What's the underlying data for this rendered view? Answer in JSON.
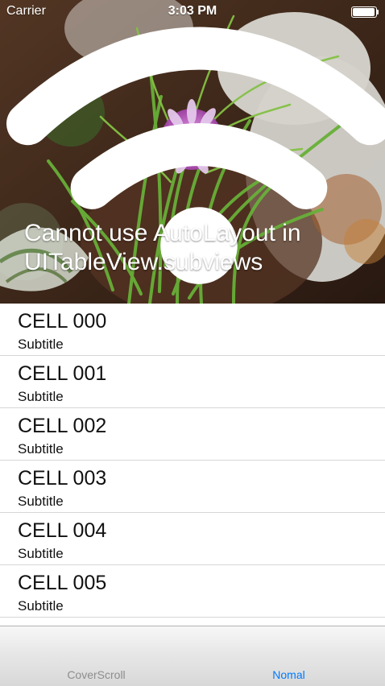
{
  "status_bar": {
    "carrier": "Carrier",
    "time": "3:03 PM"
  },
  "hero": {
    "title_line1": "Cannot use AutoLayout in",
    "title_line2": "UITableView.subviews"
  },
  "table": {
    "cells": [
      {
        "title": "CELL 000",
        "subtitle": "Subtitle"
      },
      {
        "title": "CELL 001",
        "subtitle": "Subtitle"
      },
      {
        "title": "CELL 002",
        "subtitle": "Subtitle"
      },
      {
        "title": "CELL 003",
        "subtitle": "Subtitle"
      },
      {
        "title": "CELL 004",
        "subtitle": "Subtitle"
      },
      {
        "title": "CELL 005",
        "subtitle": "Subtitle"
      }
    ]
  },
  "tab_bar": {
    "items": [
      {
        "label": "CoverScroll",
        "selected": false
      },
      {
        "label": "Nomal",
        "selected": true
      }
    ],
    "colors": {
      "selected": "#007aff",
      "unselected": "#8d8d8d"
    }
  }
}
